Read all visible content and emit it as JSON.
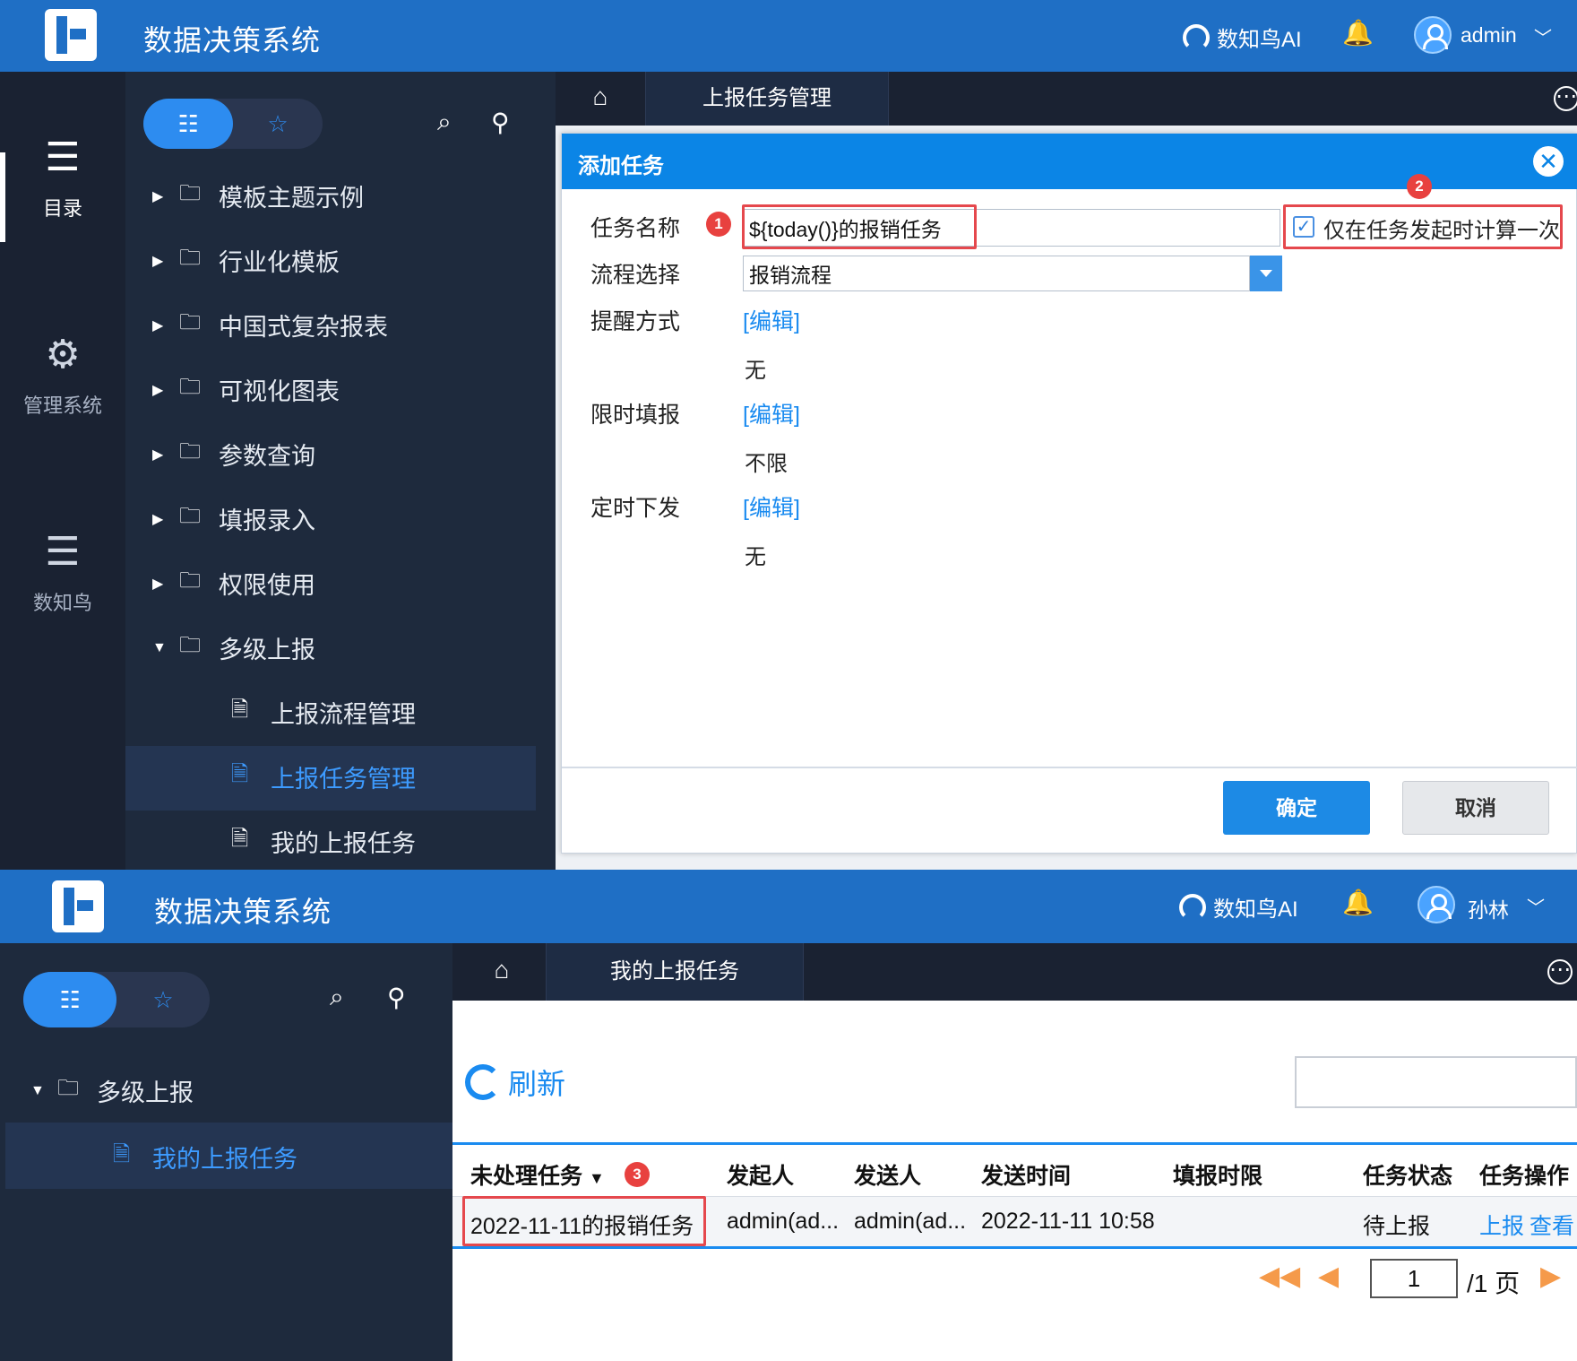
{
  "top": {
    "brand": "数据决策系统",
    "ai_label": "数知鸟AI",
    "user": "admin",
    "rail": [
      "目录",
      "管理系统",
      "数知鸟"
    ],
    "tree": [
      {
        "label": "模板主题示例",
        "arrow": "▶"
      },
      {
        "label": "行业化模板",
        "arrow": "▶"
      },
      {
        "label": "中国式复杂报表",
        "arrow": "▶"
      },
      {
        "label": "可视化图表",
        "arrow": "▶"
      },
      {
        "label": "参数查询",
        "arrow": "▶"
      },
      {
        "label": "填报录入",
        "arrow": "▶"
      },
      {
        "label": "权限使用",
        "arrow": "▶"
      },
      {
        "label": "多级上报",
        "arrow": "▼"
      }
    ],
    "children": [
      "上报流程管理",
      "上报任务管理",
      "我的上报任务"
    ],
    "tab": "上报任务管理"
  },
  "dialog": {
    "title": "添加任务",
    "fields": {
      "name_label": "任务名称",
      "name_value": "${today()}的报销任务",
      "only_once": "仅在任务发起时计算一次",
      "flow_label": "流程选择",
      "flow_value": "报销流程",
      "remind_label": "提醒方式",
      "remind_link": "[编辑]",
      "remind_value": "无",
      "limit_label": "限时填报",
      "limit_link": "[编辑]",
      "limit_value": "不限",
      "timer_label": "定时下发",
      "timer_link": "[编辑]",
      "timer_value": "无"
    },
    "ok": "确定",
    "cancel": "取消"
  },
  "badges": [
    "1",
    "2",
    "3"
  ],
  "bottom": {
    "brand": "数据决策系统",
    "ai_label": "数知鸟AI",
    "user": "孙林",
    "tree_parent": "多级上报",
    "tree_child": "我的上报任务",
    "tab": "我的上报任务",
    "refresh": "刷新",
    "columns": [
      "未处理任务",
      "发起人",
      "发送人",
      "发送时间",
      "填报时限",
      "任务状态",
      "任务操作"
    ],
    "row": {
      "task": "2022-11-11的报销任务",
      "initiator": "admin(ad...",
      "sender": "admin(ad...",
      "sent_time": "2022-11-11 10:58",
      "status": "待上报",
      "op_report": "上报",
      "op_view": "查看"
    },
    "pager": {
      "page": "1",
      "total": "/1 页"
    }
  },
  "colors": {
    "header": "#1f6fc5",
    "rail": "#1a2232",
    "tree": "#1e2a3d",
    "accent": "#2d8cf0",
    "highlight": "#e5484d"
  }
}
